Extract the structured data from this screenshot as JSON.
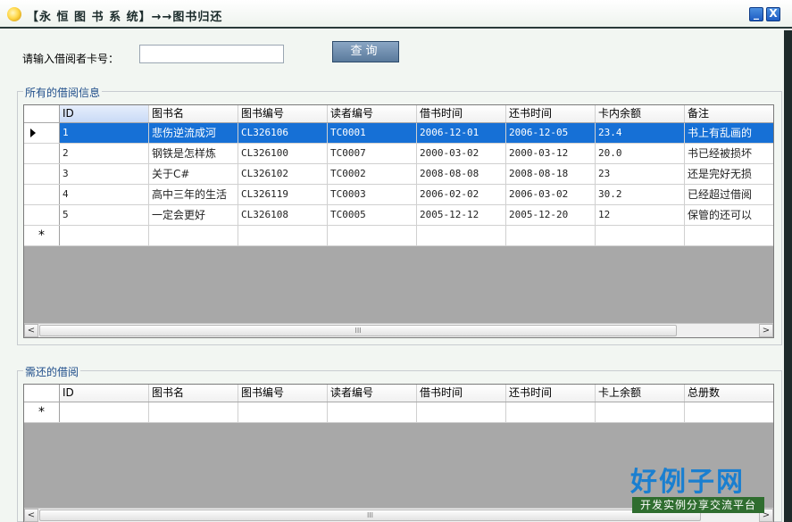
{
  "window": {
    "title": "【永 恒 图 书 系 统】→→图书归还",
    "minimize_glyph": "_",
    "close_glyph": "X"
  },
  "search": {
    "label": "请输入借阅者卡号：",
    "value": "",
    "button_label": "查询"
  },
  "borrow_group": {
    "legend": "所有的借阅信息",
    "columns": [
      "ID",
      "图书名",
      "图书编号",
      "读者编号",
      "借书时间",
      "还书时间",
      "卡内余额",
      "备注"
    ],
    "rows": [
      [
        "1",
        "悲伤逆流成河",
        "CL326106",
        "TC0001",
        "2006-12-01",
        "2006-12-05",
        "23.4",
        "书上有乱画的"
      ],
      [
        "2",
        "钢铁是怎样炼",
        "CL326100",
        "TC0007",
        "2000-03-02",
        "2000-03-12",
        "20.0",
        "书已经被损坏"
      ],
      [
        "3",
        "关于C#",
        "CL326102",
        "TC0002",
        "2008-08-08",
        "2008-08-18",
        "23",
        "还是完好无损"
      ],
      [
        "4",
        "高中三年的生活",
        "CL326119",
        "TC0003",
        "2006-02-02",
        "2006-03-02",
        "30.2",
        "已经超过借阅"
      ],
      [
        "5",
        "一定会更好",
        "CL326108",
        "TC0005",
        "2005-12-12",
        "2005-12-20",
        "12",
        "保管的还可以"
      ]
    ],
    "selected_row": 0,
    "new_row_marker": "*"
  },
  "return_group": {
    "legend": "需还的借阅",
    "columns": [
      "ID",
      "图书名",
      "图书编号",
      "读者编号",
      "借书时间",
      "还书时间",
      "卡上余额",
      "总册数"
    ],
    "new_row_marker": "*"
  },
  "scrollbar": {
    "left_glyph": "<",
    "right_glyph": ">",
    "grip_glyph": "III"
  },
  "brand": {
    "title": "好例子网",
    "subtitle": "开发实例分享交流平台"
  }
}
